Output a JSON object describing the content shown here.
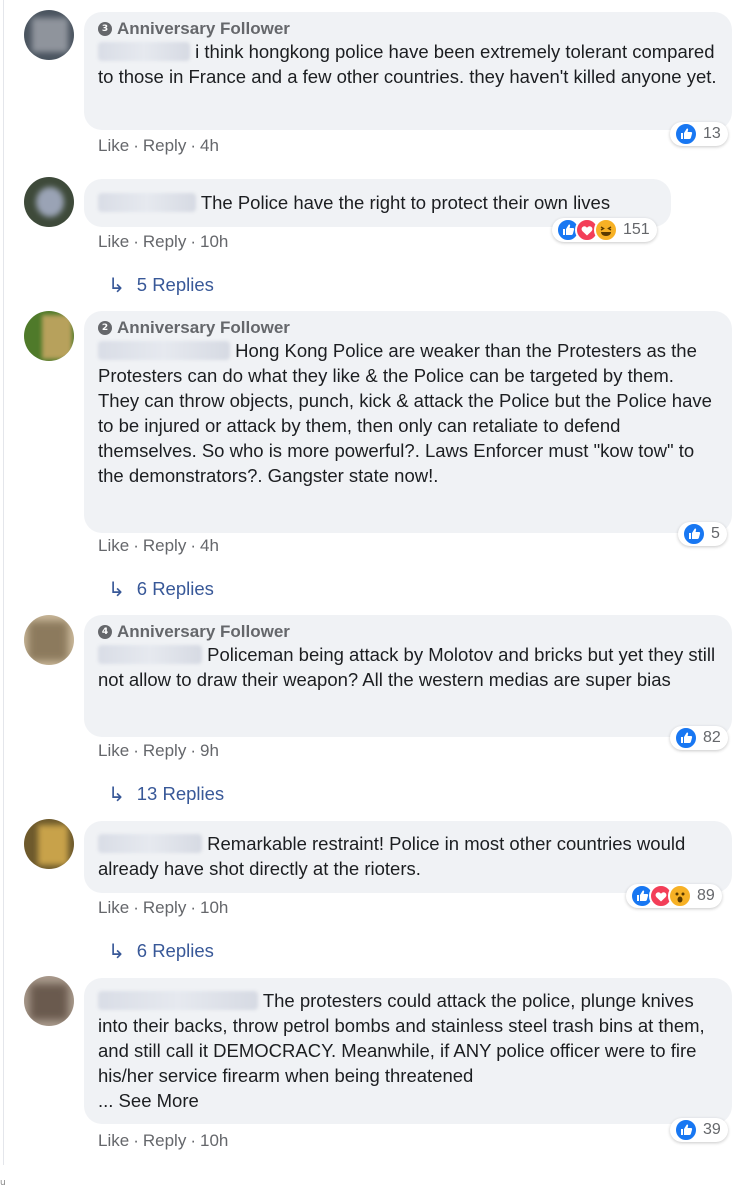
{
  "comments": [
    {
      "badge": "Anniversary Follower",
      "badge_num": "3",
      "text": "i think hongkong police have been extremely tolerant compared to those in France and a few other countries. they haven't killed anyone yet.",
      "actions": {
        "like": "Like",
        "reply": "Reply",
        "time": "4h"
      },
      "reaction_count": "13"
    },
    {
      "text": "The Police have the right to protect their own lives",
      "actions": {
        "like": "Like",
        "reply": "Reply",
        "time": "10h"
      },
      "reaction_count": "151",
      "replies": "5 Replies"
    },
    {
      "badge": "Anniversary Follower",
      "badge_num": "2",
      "text": "Hong Kong Police are weaker than the Protesters as the Protesters can do what they like & the Police can be targeted by them. They can throw objects, punch, kick & attack the Police but the Police have to be injured or attack by them, then only can retaliate to defend themselves. So who is more powerful?. Laws Enforcer must \"kow tow\" to the demonstrators?. Gangster state now!.",
      "actions": {
        "like": "Like",
        "reply": "Reply",
        "time": "4h"
      },
      "reaction_count": "5",
      "replies": "6 Replies"
    },
    {
      "badge": "Anniversary Follower",
      "badge_num": "4",
      "text": "Policeman being attack by Molotov and bricks but yet they still not allow to draw their weapon? All the western medias are super bias",
      "actions": {
        "like": "Like",
        "reply": "Reply",
        "time": "9h"
      },
      "reaction_count": "82",
      "replies": "13 Replies"
    },
    {
      "text": "Remarkable restraint! Police in most other countries would already have shot directly at the rioters.",
      "actions": {
        "like": "Like",
        "reply": "Reply",
        "time": "10h"
      },
      "reaction_count": "89",
      "replies": "6 Replies"
    },
    {
      "text": "The protesters could attack the police, plunge knives into their backs, throw petrol bombs and stainless steel trash bins at them, and still call it DEMOCRACY. Meanwhile, if ANY police officer were to fire his/her service firearm when being threatened",
      "see_more": "... See More",
      "actions": {
        "like": "Like",
        "reply": "Reply",
        "time": "10h"
      },
      "reaction_count": "39"
    }
  ],
  "separator": "·",
  "colors": {
    "like_blue": "#1877f2",
    "love_red": "#f33e58",
    "haha_yellow": "#f7b125",
    "link_blue": "#385898",
    "bubble": "#f0f2f5"
  },
  "icons": {
    "reply_arrow": "↳"
  }
}
